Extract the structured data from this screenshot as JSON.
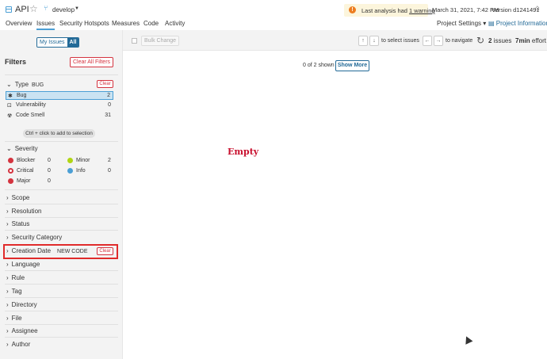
{
  "header": {
    "project_name": "API",
    "branch": "develop",
    "warning_prefix": "Last analysis had",
    "warning_link": "1 warning",
    "analysis_date": "March 31, 2021, 7:42 PM",
    "version": "Version d1241491",
    "icons": [
      "project-icon",
      "star-icon",
      "branch-icon",
      "warning-icon",
      "home-icon"
    ]
  },
  "nav": {
    "tabs": [
      "Overview",
      "Issues",
      "Security Hotspots",
      "Measures",
      "Code",
      "Activity"
    ],
    "active_tab": "Issues",
    "project_settings": "Project Settings",
    "project_information": "Project Information"
  },
  "sidebar": {
    "my_issues": "My Issues",
    "all": "All",
    "filters_title": "Filters",
    "clear_all": "Clear All Filters",
    "type": {
      "label": "Type",
      "tag": "BUG",
      "clear": "Clear",
      "items": [
        {
          "label": "Bug",
          "count": "2",
          "selected": true
        },
        {
          "label": "Vulnerability",
          "count": "0",
          "selected": false
        },
        {
          "label": "Code Smell",
          "count": "31",
          "selected": false
        }
      ],
      "hint": "Ctrl + click to add to selection"
    },
    "severity": {
      "label": "Severity",
      "items": [
        {
          "label": "Blocker",
          "count": "0",
          "color": "#d4333f"
        },
        {
          "label": "Minor",
          "count": "2",
          "color": "#b0d513"
        },
        {
          "label": "Critical",
          "count": "0",
          "color": "#d4333f"
        },
        {
          "label": "Info",
          "count": "0",
          "color": "#4b9fd5"
        },
        {
          "label": "Major",
          "count": "0",
          "color": "#d4333f"
        }
      ]
    },
    "facets": {
      "scope": "Scope",
      "resolution": "Resolution",
      "status": "Status",
      "security_category": "Security Category",
      "creation_date": "Creation Date",
      "creation_tag": "NEW CODE",
      "creation_clear": "Clear",
      "language": "Language",
      "rule": "Rule",
      "tag": "Tag",
      "directory": "Directory",
      "file": "File",
      "assignee": "Assignee",
      "author": "Author"
    }
  },
  "toolbar": {
    "bulk_change": "Bulk Change",
    "up_key": "↑",
    "down_key": "↓",
    "select_issues": "to select issues",
    "left_key": "←",
    "right_key": "→",
    "navigate": "to navigate",
    "issues_count": "2",
    "issues_word": "issues",
    "effort_value": "7min",
    "effort_word": "effort"
  },
  "main": {
    "shown": "0 of 2 shown",
    "show_more": "Show More",
    "empty": "Empty"
  }
}
